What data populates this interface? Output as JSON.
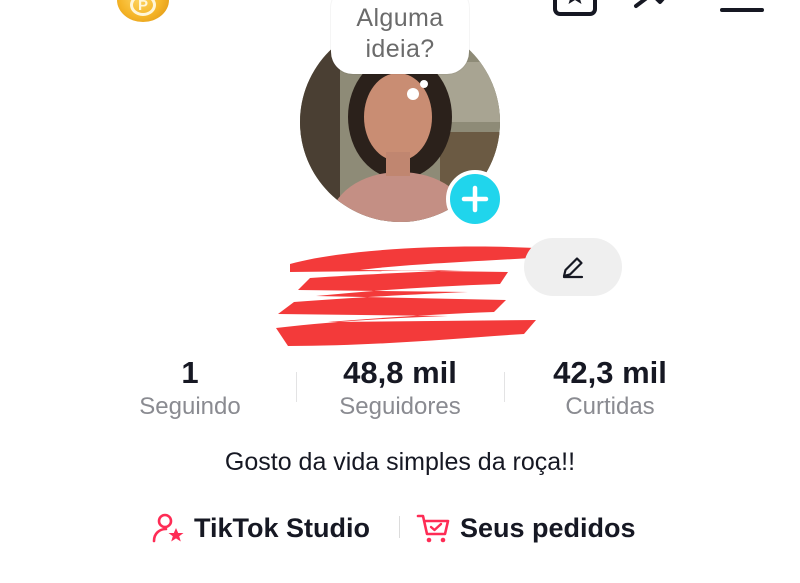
{
  "header": {
    "add_friend_icon": "person-add-icon",
    "coin_icon": "coin-icon",
    "coin_letter": "P",
    "favorites_icon": "bookmark-star-icon",
    "analytics_icon": "trend-arrow-icon",
    "menu_icon": "hamburger-menu-icon"
  },
  "profile": {
    "bubble_line1": "Alguma",
    "bubble_line2": "ideia?",
    "avatar_icon": "profile-photo",
    "add_photo_icon": "plus-icon",
    "edit_icon": "pencil-icon",
    "bio": "Gosto da vida simples da roça!!"
  },
  "stats": {
    "following_count": "1",
    "following_label": "Seguindo",
    "followers_count": "48,8 mil",
    "followers_label": "Seguidores",
    "likes_count": "42,3 mil",
    "likes_label": "Curtidas"
  },
  "links": {
    "studio_label": "TikTok Studio",
    "studio_icon": "person-star-icon",
    "orders_label": "Seus pedidos",
    "orders_icon": "cart-icon"
  },
  "colors": {
    "accent_pink": "#fe2c55",
    "add_blue": "#20d5ec",
    "redaction_red": "#f33a3a",
    "muted_text": "#8a8b91"
  }
}
